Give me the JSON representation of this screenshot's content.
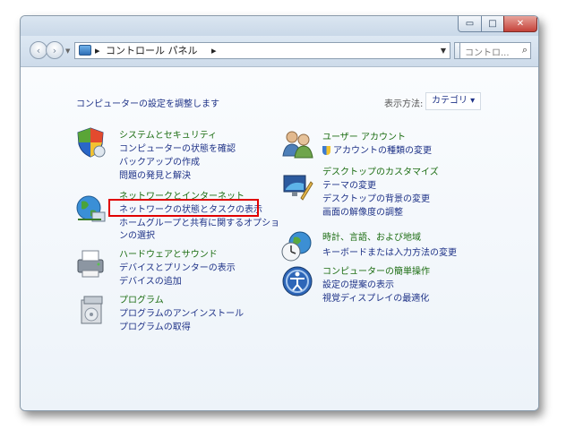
{
  "window": {
    "buttons": {
      "minimize": "▭",
      "maximize": "□",
      "close": "✕"
    }
  },
  "nav": {
    "back": "‹",
    "forward": "›",
    "breadcrumb": [
      "▸",
      "コントロール パネル",
      "▸"
    ],
    "refresh": "↻",
    "search_placeholder": "コントロ...",
    "search_icon": "⌕"
  },
  "main": {
    "heading": "コンピューターの設定を調整します",
    "view_by_label": "表示方法:",
    "view_by_value": "カテゴリ ▾"
  },
  "left_categories": [
    {
      "icon": "shield-icon",
      "title": "システムとセキュリティ",
      "links": [
        "コンピューターの状態を確認",
        "バックアップの作成",
        "問題の発見と解決"
      ]
    },
    {
      "icon": "network-globe-icon",
      "title": "ネットワークとインターネット",
      "links": [
        "ネットワークの状態とタスクの表示",
        "ホームグループと共有に関するオプショ",
        "ンの選択"
      ]
    },
    {
      "icon": "printer-icon",
      "title": "ハードウェアとサウンド",
      "links": [
        "デバイスとプリンターの表示",
        "デバイスの追加"
      ]
    },
    {
      "icon": "programs-icon",
      "title": "プログラム",
      "links": [
        "プログラムのアンインストール",
        "プログラムの取得"
      ]
    }
  ],
  "right_categories": [
    {
      "icon": "users-icon",
      "title": "ユーザー アカウント",
      "links": [
        "アカウントの種類の変更"
      ]
    },
    {
      "icon": "desktop-personalize-icon",
      "title": "デスクトップのカスタマイズ",
      "links": [
        "テーマの変更",
        "デスクトップの背景の変更",
        "画面の解像度の調整"
      ]
    },
    {
      "icon": "clock-globe-icon",
      "title": "時計、言語、および地域",
      "links": [
        "キーボードまたは入力方法の変更"
      ]
    },
    {
      "icon": "ease-of-access-icon",
      "title": "コンピューターの簡単操作",
      "links": [
        "設定の提案の表示",
        "視覚ディスプレイの最適化"
      ]
    }
  ],
  "colors": {
    "link": "#1e3287",
    "category_title": "#1c6d12",
    "highlight_box": "#e00000"
  }
}
